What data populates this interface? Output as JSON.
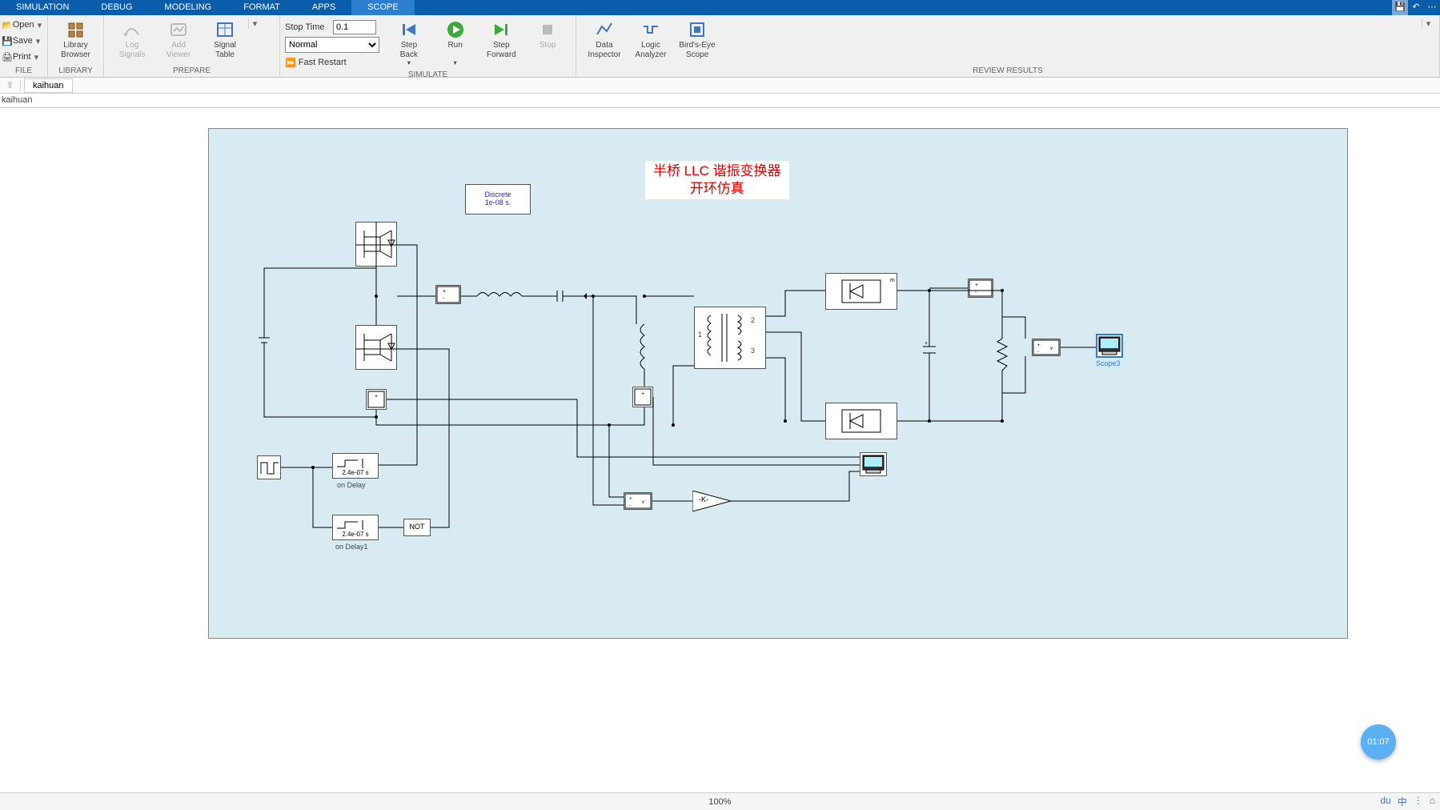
{
  "tabs": {
    "items": [
      "SIMULATION",
      "DEBUG",
      "MODELING",
      "FORMAT",
      "APPS",
      "SCOPE"
    ],
    "active_index": 5
  },
  "ribbon": {
    "file": {
      "open": "Open",
      "save": "Save",
      "print": "Print",
      "group": "FILE"
    },
    "library": {
      "library_browser": "Library\nBrowser",
      "group": "LIBRARY"
    },
    "prepare": {
      "log_signals": "Log\nSignals",
      "add_viewer": "Add\nViewer",
      "signal_table": "Signal\nTable",
      "group": "PREPARE"
    },
    "simulate": {
      "stop_time_label": "Stop Time",
      "stop_time_value": "0.1",
      "mode_value": "Normal",
      "fast_restart": "Fast Restart",
      "step_back": "Step\nBack",
      "run": "Run",
      "step_forward": "Step\nForward",
      "stop": "Stop",
      "group": "SIMULATE"
    },
    "review": {
      "data_inspector": "Data\nInspector",
      "logic_analyzer": "Logic\nAnalyzer",
      "birdseye_scope": "Bird's-Eye\nScope",
      "group": "REVIEW RESULTS"
    }
  },
  "nav": {
    "crumb": "kaihuan",
    "path": "kaihuan"
  },
  "diagram": {
    "title_line1": "半桥 LLC 谐振变换器",
    "title_line2": "开环仿真",
    "discrete_line1": "Discrete",
    "discrete_line2": "1e-08 s.",
    "on_delay_val": "2.4e-07 s",
    "on_delay_lbl": "on Delay",
    "on_delay1_lbl": "on Delay1",
    "not_label": "NOT",
    "gain_label": "-K-",
    "xfmr_1": "1",
    "xfmr_2": "2",
    "xfmr_3": "3",
    "scope3_lbl": "Scope3"
  },
  "status": {
    "zoom": "100%"
  },
  "timer": {
    "value": "01:07"
  },
  "tray": {
    "items": [
      "du",
      "中",
      "⋮",
      "⌂"
    ]
  }
}
